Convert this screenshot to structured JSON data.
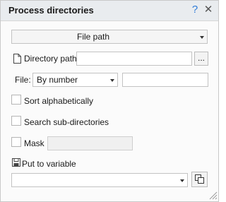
{
  "window": {
    "title": "Process directories"
  },
  "mode_select": {
    "value": "File path"
  },
  "directory_path": {
    "label": "Directory path",
    "value": "",
    "browse_label": "..."
  },
  "file": {
    "label": "File:",
    "mode_value": "By number",
    "value": ""
  },
  "sort_alphabetically": {
    "label": "Sort alphabetically",
    "checked": false
  },
  "search_subdirectories": {
    "label": "Search sub-directories",
    "checked": false
  },
  "mask": {
    "label": "Mask",
    "checked": false,
    "value": ""
  },
  "put_to_variable": {
    "label": "Put to variable",
    "value": ""
  },
  "icons": {
    "help": "help-icon",
    "close": "close-icon",
    "dropdown": "chevron-down-icon",
    "file": "file-icon",
    "save": "floppy-disk-icon",
    "copy": "copy-icon",
    "resize": "resize-grip-icon"
  },
  "colors": {
    "help_icon": "#2f7bd8",
    "titlebar": "#e9ecef"
  }
}
